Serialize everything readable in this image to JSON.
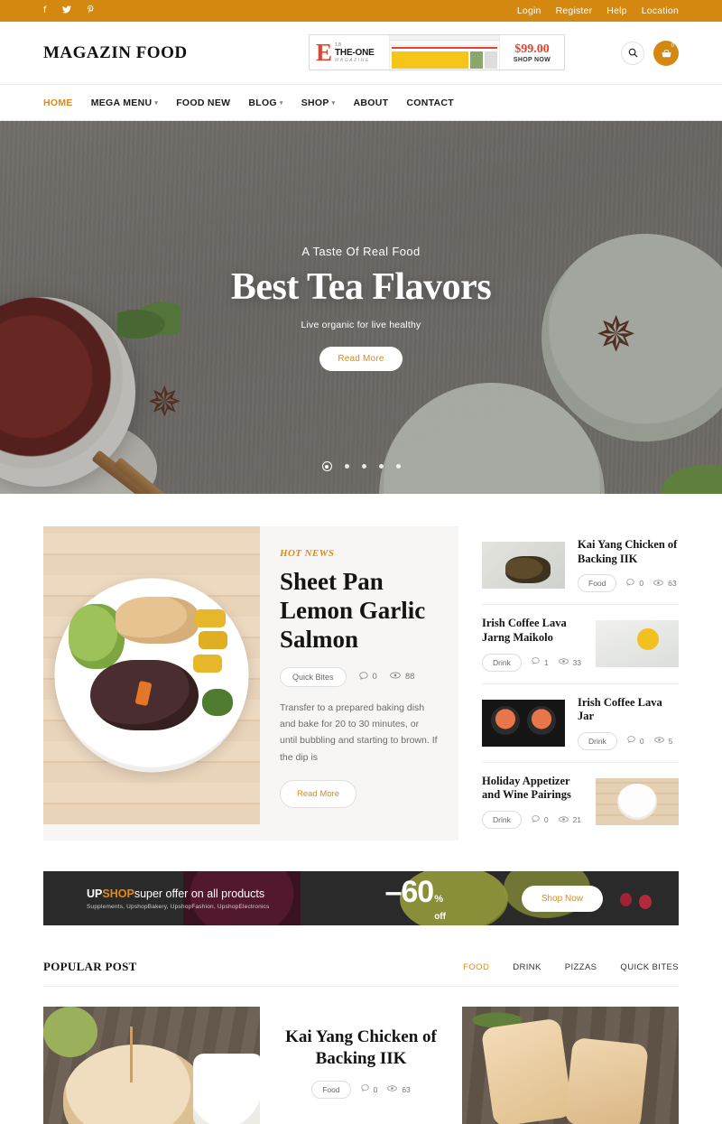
{
  "topbar": {
    "social": [
      {
        "name": "facebook-icon",
        "glyph": "f"
      },
      {
        "name": "twitter-icon",
        "glyph": "•"
      },
      {
        "name": "pinterest-icon",
        "glyph": "P"
      }
    ],
    "links": [
      "Login",
      "Register",
      "Help",
      "Location"
    ]
  },
  "header": {
    "logo": "MAGAZIN FOOD",
    "ad": {
      "version": "1.8",
      "brand_letter": "E",
      "brand": "THE-ONE",
      "brand_sub": "MAGAZINE",
      "price": "$99.00",
      "cta": "SHOP NOW"
    },
    "search_icon": "⌕",
    "cart_icon": "⛁",
    "cart_count": "0"
  },
  "nav": [
    {
      "label": "HOME",
      "active": true,
      "caret": ""
    },
    {
      "label": "MEGA MENU",
      "active": false,
      "caret": "⌄"
    },
    {
      "label": "FOOD NEW",
      "active": false,
      "caret": ""
    },
    {
      "label": "BLOG",
      "active": false,
      "caret": "⌄"
    },
    {
      "label": "SHOP",
      "active": false,
      "caret": "⌄"
    },
    {
      "label": "ABOUT",
      "active": false,
      "caret": ""
    },
    {
      "label": "CONTACT",
      "active": false,
      "caret": ""
    }
  ],
  "hero": {
    "eyebrow": "A Taste Of Real Food",
    "title": "Best Tea Flavors",
    "subtitle": "Live organic for live healthy",
    "button": "Read More",
    "slide_count": 5,
    "active_slide": 1
  },
  "hotnews": {
    "tag": "HOT NEWS",
    "title": "Sheet Pan Lemon Garlic Salmon",
    "category": "Quick Bites",
    "comments": "0",
    "views": "88",
    "excerpt": "Transfer to a prepared baking dish and bake for 20 to 30 minutes, or until bubbling and starting to brown. If the dip is",
    "button": "Read More"
  },
  "sidelist": [
    {
      "title": "Kai Yang Chicken of Backing IIK",
      "category": "Food",
      "comments": "0",
      "views": "63",
      "image_first": true
    },
    {
      "title": "Irish Coffee Lava Jarng Maikolo",
      "category": "Drink",
      "comments": "1",
      "views": "33",
      "image_first": false
    },
    {
      "title": "Irish Coffee Lava Jar",
      "category": "Drink",
      "comments": "0",
      "views": "5",
      "image_first": true
    },
    {
      "title": "Holiday Appetizer and Wine Pairings",
      "category": "Drink",
      "comments": "0",
      "views": "21",
      "image_first": false
    }
  ],
  "promo": {
    "brand_a": "UP",
    "brand_b": "SHOP",
    "headline": "super offer on all products",
    "subtext": "Supplements, UpshopBakery, UpshopFashion, UpshopElectronics",
    "discount": "–60",
    "percent": "%",
    "off": "off",
    "button": "Shop Now"
  },
  "popular": {
    "title": "POPULAR POST",
    "tabs": [
      {
        "label": "FOOD",
        "active": true
      },
      {
        "label": "DRINK",
        "active": false
      },
      {
        "label": "PIZZAS",
        "active": false
      },
      {
        "label": "QUICK BITES",
        "active": false
      }
    ],
    "feature": {
      "title": "Kai Yang Chicken of Backing IIK",
      "category": "Food",
      "comments": "0",
      "views": "63"
    }
  },
  "colors": {
    "accent": "#e08a12",
    "topbar": "#d4880f",
    "dark": "#2a2a2a",
    "ad_red": "#e8402a"
  },
  "icons": {
    "comment": "○",
    "eye": "◎"
  }
}
